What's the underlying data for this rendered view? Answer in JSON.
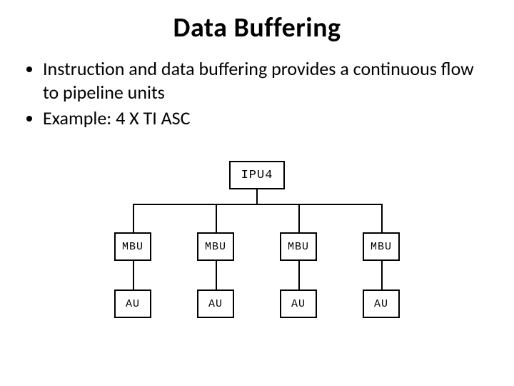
{
  "title": "Data Buffering",
  "bullets": [
    "Instruction and data buffering provides a continuous flow to pipeline units",
    "Example:  4 X TI ASC"
  ],
  "diagram": {
    "root": {
      "label": "IPU4"
    },
    "branches": [
      {
        "mbu": "MBU",
        "au": "AU"
      },
      {
        "mbu": "MBU",
        "au": "AU"
      },
      {
        "mbu": "MBU",
        "au": "AU"
      },
      {
        "mbu": "MBU",
        "au": "AU"
      }
    ]
  }
}
